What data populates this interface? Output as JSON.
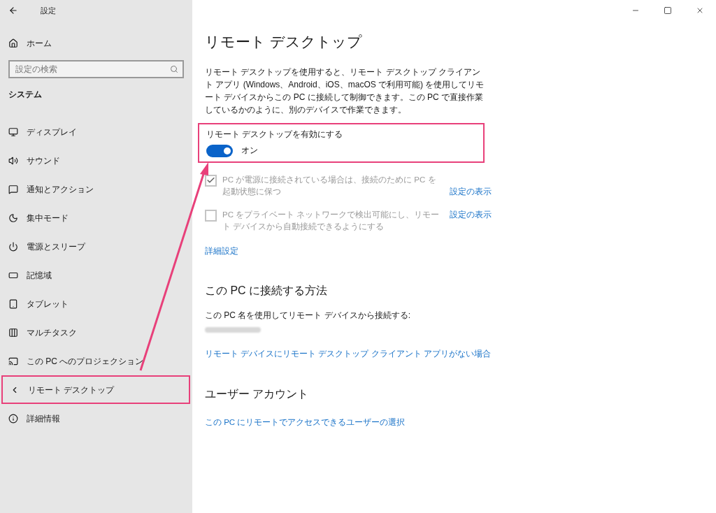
{
  "window": {
    "title": "設定"
  },
  "sidebar": {
    "home": "ホーム",
    "search": {
      "placeholder": "設定の検索"
    },
    "section": "システム",
    "items": [
      {
        "label": "ディスプレイ",
        "highlighted": false
      },
      {
        "label": "サウンド",
        "highlighted": false
      },
      {
        "label": "通知とアクション",
        "highlighted": false
      },
      {
        "label": "集中モード",
        "highlighted": false
      },
      {
        "label": "電源とスリープ",
        "highlighted": false
      },
      {
        "label": "記憶域",
        "highlighted": false
      },
      {
        "label": "タブレット",
        "highlighted": false
      },
      {
        "label": "マルチタスク",
        "highlighted": false
      },
      {
        "label": "この PC へのプロジェクション",
        "highlighted": false
      },
      {
        "label": "リモート デスクトップ",
        "highlighted": true
      },
      {
        "label": "詳細情報",
        "highlighted": false
      }
    ]
  },
  "main": {
    "title": "リモート デスクトップ",
    "description": "リモート デスクトップを使用すると、リモート デスクトップ クライアント アプリ (Windows、Android、iOS、macOS で利用可能) を使用してリモート デバイスからこの PC に接続して制御できます。この PC で直接作業しているかのように、別のデバイスで作業できます。",
    "toggle": {
      "label": "リモート デスクトップを有効にする",
      "on": true,
      "state_text": "オン",
      "highlighted": true
    },
    "options": [
      {
        "label": "PC が電源に接続されている場合は、接続のために PC を起動状態に保つ",
        "checked": true,
        "disabled": true,
        "link": "設定の表示"
      },
      {
        "label": "PC をプライベート ネットワークで検出可能にし、リモート デバイスから自動接続できるようにする",
        "checked": false,
        "disabled": true,
        "link": "設定の表示"
      }
    ],
    "advanced_link": "詳細設定",
    "connect": {
      "heading": "この PC に接続する方法",
      "text": "この PC 名を使用してリモート デバイスから接続する:",
      "link": "リモート デバイスにリモート デスクトップ クライアント アプリがない場合"
    },
    "accounts": {
      "heading": "ユーザー アカウント",
      "link": "この PC にリモートでアクセスできるユーザーの選択"
    }
  }
}
